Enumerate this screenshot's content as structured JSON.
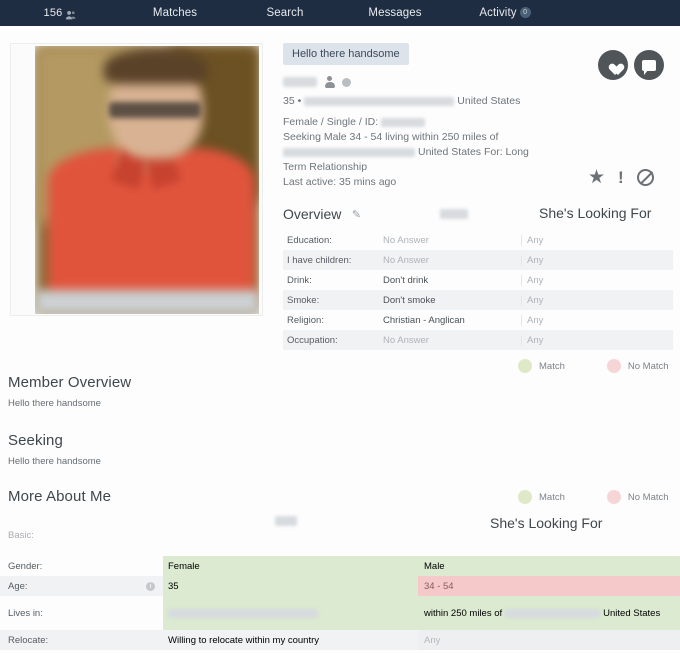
{
  "nav": {
    "count": "156",
    "count_icon": "people-icon",
    "items": [
      {
        "label": "Matches"
      },
      {
        "label": "Search"
      },
      {
        "label": "Messages"
      },
      {
        "label": "Activity",
        "badge": "0"
      }
    ]
  },
  "profile": {
    "greeting_tag": "Hello there handsome",
    "age_prefix": "35 •",
    "country": "United States",
    "detail_line": "Female / Single / ID:",
    "seeking_line1": "Seeking Male 34 - 54 living within 250 miles of",
    "seeking_line2_country": "United States For: Long",
    "seeking_line3": "Term Relationship",
    "last_active": "Last active: 35 mins ago",
    "actions": {
      "favourite_icon": "heart-icon",
      "message_icon": "chat-bubble-icon",
      "star_icon": "★",
      "report_icon": "!",
      "block_icon": "ban-icon"
    }
  },
  "overview": {
    "title": "Overview",
    "edit_icon": "pencil-icon",
    "looking_for_title": "She's Looking For",
    "rows": [
      {
        "label": "Education:",
        "value": "No Answer",
        "dim": true,
        "looking": "Any"
      },
      {
        "label": "I have children:",
        "value": "No Answer",
        "dim": true,
        "looking": "Any"
      },
      {
        "label": "Drink:",
        "value": "Don't drink",
        "dim": false,
        "looking": "Any"
      },
      {
        "label": "Smoke:",
        "value": "Don't smoke",
        "dim": false,
        "looking": "Any"
      },
      {
        "label": "Religion:",
        "value": "Christian - Anglican",
        "dim": false,
        "looking": "Any"
      },
      {
        "label": "Occupation:",
        "value": "No Answer",
        "dim": true,
        "looking": "Any"
      }
    ]
  },
  "legend": {
    "match_label": "Match",
    "no_match_label": "No Match",
    "match_color": "#dfe9c8",
    "no_match_color": "#f6d5d6"
  },
  "sections": {
    "member_overview": {
      "title": "Member Overview",
      "body": "Hello there handsome"
    },
    "seeking": {
      "title": "Seeking",
      "body": "Hello there handsome"
    },
    "more_about_me": {
      "title": "More About Me"
    }
  },
  "more_about_me": {
    "looking_for_title": "She's Looking For",
    "group_label": "Basic:",
    "rows": [
      {
        "label": "Gender:",
        "value": "Female",
        "value_state": "g",
        "looking": "Male",
        "looking_state": "g"
      },
      {
        "label": "Age:",
        "value": "35",
        "value_state": "g",
        "looking": "34 - 54",
        "looking_state": "r",
        "info_icon": "info-icon"
      },
      {
        "label": "Lives in:",
        "value": "",
        "value_state": "g",
        "value_redacted": true,
        "looking_prefix": "within 250 miles of",
        "looking_suffix": "United States",
        "looking_state": "g",
        "looking_redacted": true
      },
      {
        "label": "Relocate:",
        "value": "Willing to relocate within my country",
        "value_state": "plain",
        "looking": "Any",
        "looking_state": "n"
      }
    ]
  },
  "colors": {
    "nav_bg": "#1e2d42",
    "match_green": "#dbead0",
    "no_match_red": "#f5c9c9"
  }
}
